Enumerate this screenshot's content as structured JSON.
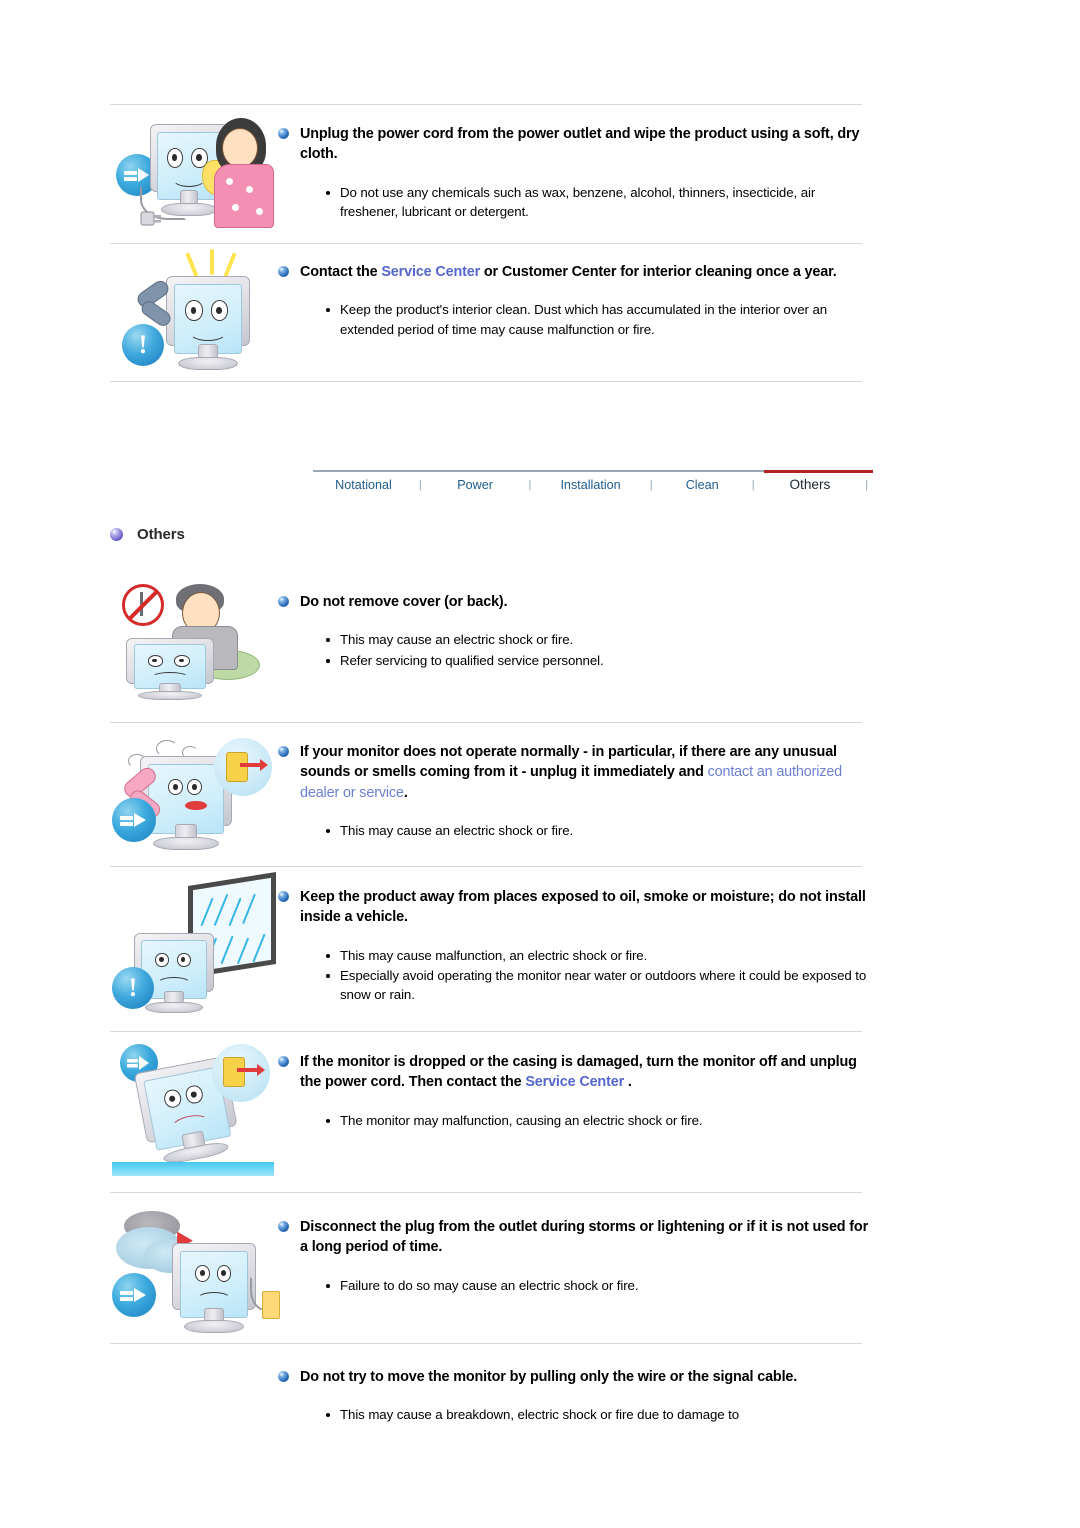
{
  "document": {
    "title": "Safety Instructions - Others"
  },
  "tabs": {
    "items": [
      {
        "label": "Notational",
        "active": false
      },
      {
        "label": "Power",
        "active": false
      },
      {
        "label": "Installation",
        "active": false
      },
      {
        "label": "Clean",
        "active": false
      },
      {
        "label": "Others",
        "active": true
      }
    ],
    "separator": "|",
    "active_underline_color": "#b22222",
    "link_color": "#1f5c8b"
  },
  "section_heading": {
    "label": "Others",
    "bullet_color": "#6f62c8"
  },
  "colors": {
    "bullet_blue": "#1559a8",
    "link_blue": "#5566cc",
    "link_line_blue": "#6b7fd4",
    "divider": "#d8d8d8"
  },
  "sections": [
    {
      "id": "wipe-with-cloth",
      "headline_parts": [
        {
          "text": "Unplug the power cord from the power outlet and wipe the product using a soft, dry cloth.",
          "style": "bold"
        }
      ],
      "notes": [
        "Do not use any chemicals such as wax, benzene, alcohol, thinners, insecticide, air freshener, lubricant or detergent."
      ],
      "illustration": "woman-wiping-monitor"
    },
    {
      "id": "contact-service-center",
      "headline_parts": [
        {
          "text": "Contact the ",
          "style": "bold"
        },
        {
          "text": "Service Center",
          "style": "link"
        },
        {
          "text": " or Customer Center for interior cleaning once a year.",
          "style": "bold"
        }
      ],
      "notes": [
        "Keep the product's interior clean. Dust which has accumulated in the interior over an extended period of time may cause malfunction or fire."
      ],
      "illustration": "monitor-with-phone"
    },
    {
      "id": "do-not-remove-cover",
      "headline_parts": [
        {
          "text": "Do not remove cover (or back).",
          "style": "bold"
        }
      ],
      "notes": [
        "This may cause an electric shock or fire.",
        "Refer servicing to qualified service personnel."
      ],
      "illustration": "man-opening-monitor-prohibited"
    },
    {
      "id": "abnormal-operation",
      "headline_parts": [
        {
          "text": "If your monitor does not operate normally - in particular, if there are any unusual sounds or smells coming from it - unplug it immediately and ",
          "style": "bold"
        },
        {
          "text": "contact an authorized dealer or service",
          "style": "link-line"
        },
        {
          "text": ".",
          "style": "bold"
        }
      ],
      "notes": [
        "This may cause an electric shock or fire."
      ],
      "illustration": "smoking-monitor-unplug"
    },
    {
      "id": "keep-away-from-moisture",
      "headline_parts": [
        {
          "text": "Keep the product away from places exposed to oil, smoke or moisture; do not install inside a vehicle.",
          "style": "bold"
        }
      ],
      "notes": [
        "This may cause malfunction, an electric shock or fire.",
        "Especially avoid operating the monitor near water or outdoors where it could be exposed to snow or rain."
      ],
      "illustration": "monitor-near-rainy-window"
    },
    {
      "id": "dropped-or-damaged",
      "headline_parts": [
        {
          "text": "If the monitor is dropped or the casing is damaged, turn the monitor off and unplug the power cord. Then contact the ",
          "style": "bold"
        },
        {
          "text": "Service Center",
          "style": "link"
        },
        {
          "text": " .",
          "style": "bold"
        }
      ],
      "notes": [
        "The monitor may malfunction, causing an electric shock or fire."
      ],
      "illustration": "tilting-damaged-monitor"
    },
    {
      "id": "disconnect-during-storms",
      "headline_parts": [
        {
          "text": "Disconnect the plug from the outlet during storms or lightening or if it is not used for a long period of time.",
          "style": "bold"
        }
      ],
      "notes": [
        "Failure to do so may cause an electric shock or fire."
      ],
      "illustration": "storm-cloud-unplug"
    },
    {
      "id": "do-not-pull-cable",
      "headline_parts": [
        {
          "text": "Do not try to move the monitor by pulling only the wire or the signal cable.",
          "style": "bold"
        }
      ],
      "notes": [
        "This may cause a breakdown, electric shock or fire due to damage to"
      ],
      "illustration": "none"
    }
  ]
}
